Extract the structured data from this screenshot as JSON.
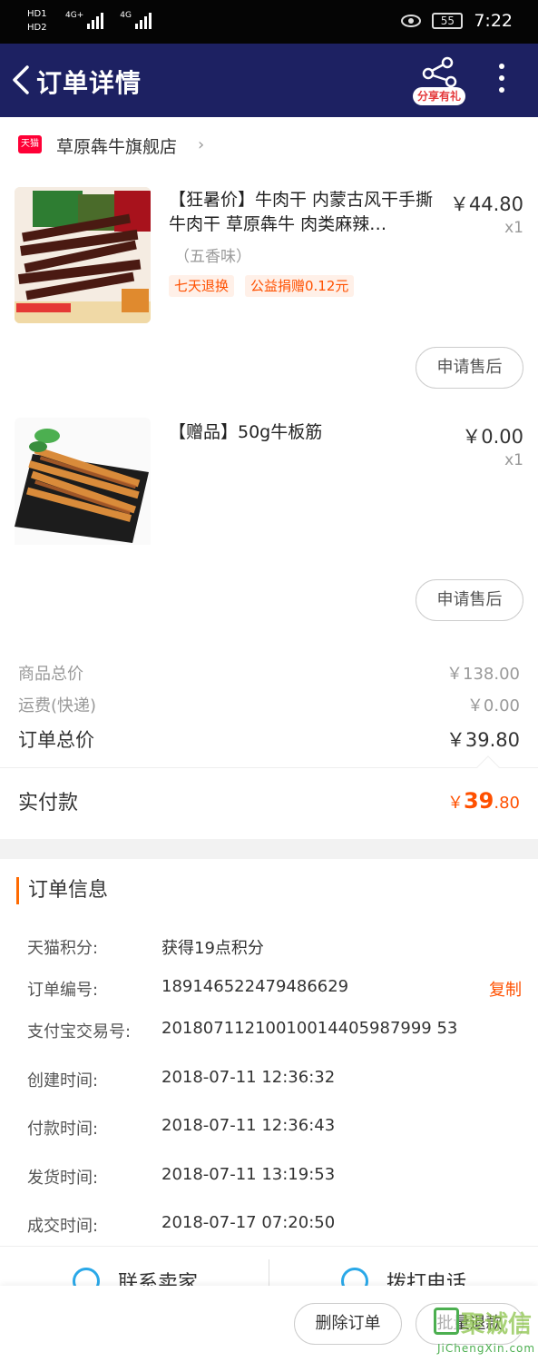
{
  "status_bar": {
    "hd1": "HD1",
    "hd2": "HD2",
    "net1": "4G+",
    "net2": "4G",
    "battery": "55",
    "time": "7:22"
  },
  "header": {
    "title": "订单详情",
    "share_label": "分享有礼"
  },
  "store": {
    "badge": "天猫",
    "name": "草原犇牛旗舰店"
  },
  "products": [
    {
      "title": "【狂暑价】牛肉干 内蒙古风干手撕牛肉干 草原犇牛 肉类麻辣…",
      "price": "￥44.80",
      "qty": "x1",
      "spec": "（五香味）",
      "tags": [
        "七天退换",
        "公益捐赠0.12元"
      ],
      "after_sale": "申请售后"
    },
    {
      "title": "【赠品】50g牛板筋",
      "price": "￥0.00",
      "qty": "x1",
      "after_sale": "申请售后"
    }
  ],
  "summary": {
    "goods_label": "商品总价",
    "goods_value": "￥138.00",
    "shipping_label": "运费(快递)",
    "shipping_value": "￥0.00",
    "total_label": "订单总价",
    "total_value": "￥39.80",
    "paid_label": "实付款",
    "paid_currency": "￥",
    "paid_int": "39",
    "paid_dec": ".80"
  },
  "order_info": {
    "heading": "订单信息",
    "rows": [
      {
        "k": "天猫积分:",
        "v": "获得19点积分"
      },
      {
        "k": "订单编号:",
        "v": "189146522479486629"
      },
      {
        "k": "支付宝交易号:",
        "v": "20180711210010014405987999 53"
      },
      {
        "k": "创建时间:",
        "v": "2018-07-11 12:36:32"
      },
      {
        "k": "付款时间:",
        "v": "2018-07-11 12:36:43"
      },
      {
        "k": "发货时间:",
        "v": "2018-07-11 13:19:53"
      },
      {
        "k": "成交时间:",
        "v": "2018-07-17 07:20:50"
      }
    ],
    "copy_label": "复制"
  },
  "contact": {
    "seller": "联系卖家",
    "phone": "拨打电话"
  },
  "bottom": {
    "delete": "删除订单",
    "refund": "批量退款"
  },
  "watermark": {
    "text": "聚诚信",
    "url": "JiChengXin.com"
  },
  "colors": {
    "app_bar": "#1d2162",
    "accent": "#ff5000"
  }
}
